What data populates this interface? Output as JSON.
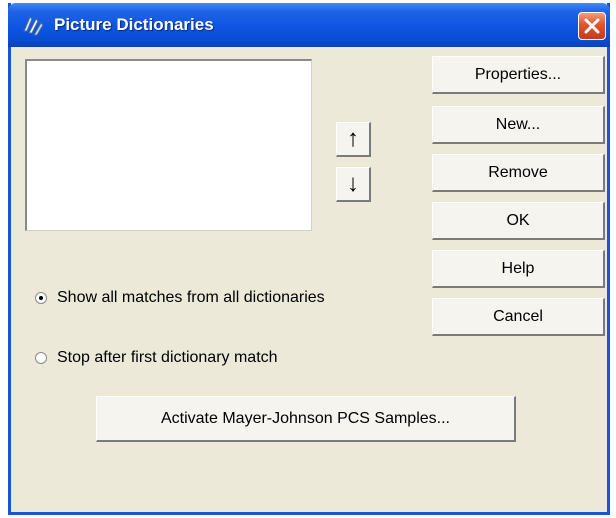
{
  "window": {
    "title": "Picture Dictionaries",
    "app_icon": "dictionary-app-icon",
    "close_icon": "close-icon"
  },
  "dictionary_list": {
    "items": []
  },
  "reorder": {
    "move_up_icon": "arrow-up-icon",
    "move_down_icon": "arrow-down-icon",
    "move_up_glyph": "↑",
    "move_down_glyph": "↓"
  },
  "buttons": {
    "properties": "Properties...",
    "new": "New...",
    "remove": "Remove",
    "ok": "OK",
    "help": "Help",
    "cancel": "Cancel",
    "activate": "Activate Mayer-Johnson PCS Samples..."
  },
  "options": {
    "show_all": {
      "label": "Show all matches from all dictionaries",
      "checked": true
    },
    "stop_first": {
      "label": "Stop after first dictionary match",
      "checked": false
    }
  },
  "colors": {
    "titlebar": "#0e55e3",
    "dialog_bg": "#ece9d8",
    "close_button": "#e0542d"
  }
}
